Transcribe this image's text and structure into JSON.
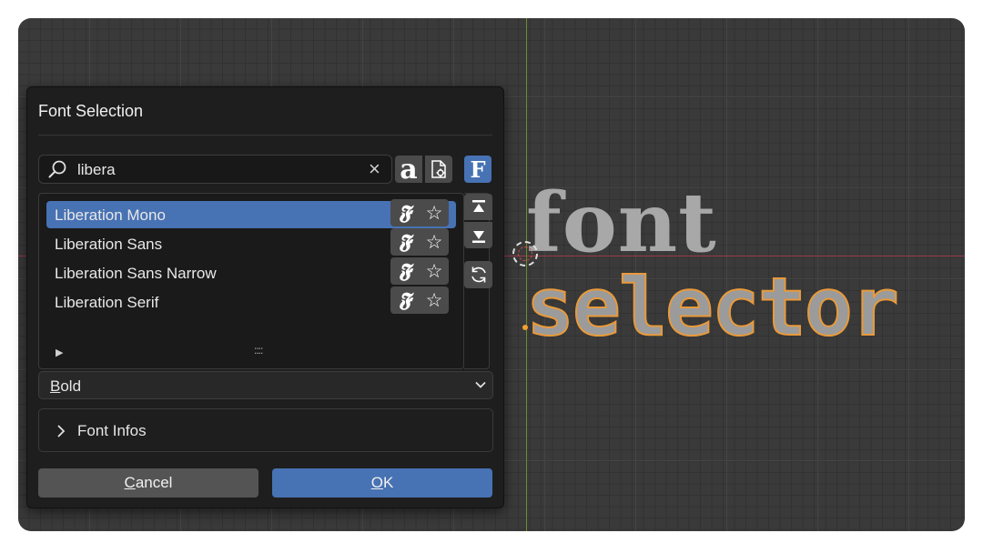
{
  "viewport": {
    "text_line1": "font",
    "text_line2": "selector"
  },
  "dialog": {
    "title": "Font Selection",
    "search": {
      "value": "libera",
      "placeholder": ""
    },
    "fonts": [
      {
        "label": "Liberation Mono",
        "selected": true
      },
      {
        "label": "Liberation Sans",
        "selected": false
      },
      {
        "label": "Liberation Sans Narrow",
        "selected": false
      },
      {
        "label": "Liberation Serif",
        "selected": false
      }
    ],
    "row_icon_glyph": "𝕱",
    "star_glyph": "☆",
    "preview_glyph": "a",
    "bold_glyph": "F",
    "list_grip": "::::",
    "style": {
      "mnemonic": "B",
      "rest": "old"
    },
    "font_infos_label": "Font Infos",
    "cancel": {
      "mnemonic": "C",
      "rest": "ancel"
    },
    "ok": {
      "mnemonic": "O",
      "rest": "K"
    }
  },
  "colors": {
    "accent": "#4772b3",
    "outline": "#e99a3a",
    "x_axis": "#9a3b47",
    "y_axis": "#6c8a2c"
  },
  "icons": [
    "search-icon",
    "clear-icon",
    "font-preview-icon",
    "file-settings-icon",
    "bold-font-icon",
    "font-style-icon",
    "star-icon",
    "move-top-icon",
    "move-bottom-icon",
    "refresh-icon",
    "chevron-down-icon",
    "chevron-right-icon"
  ]
}
